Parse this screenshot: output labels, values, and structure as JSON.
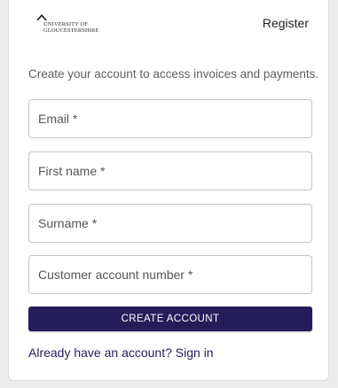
{
  "header": {
    "logo": {
      "icon": "university-crest-chevron-icon",
      "line1": "UNIVERSITY OF",
      "line2": "GLOUCESTERSHIRE"
    },
    "register_label": "Register"
  },
  "intro_text": "Create your account to access invoices and payments.",
  "form": {
    "email": {
      "value": "",
      "placeholder": "Email *"
    },
    "first_name": {
      "value": "",
      "placeholder": "First name *"
    },
    "surname": {
      "value": "",
      "placeholder": "Surname *"
    },
    "customer_account_number": {
      "value": "",
      "placeholder": "Customer account number *"
    },
    "submit_label": "CREATE ACCOUNT"
  },
  "footer": {
    "signin_label": "Already have an account? Sign in"
  },
  "colors": {
    "primary": "#251d5a",
    "background": "#ececec",
    "card": "#ffffff",
    "border": "#c4c4c4"
  }
}
